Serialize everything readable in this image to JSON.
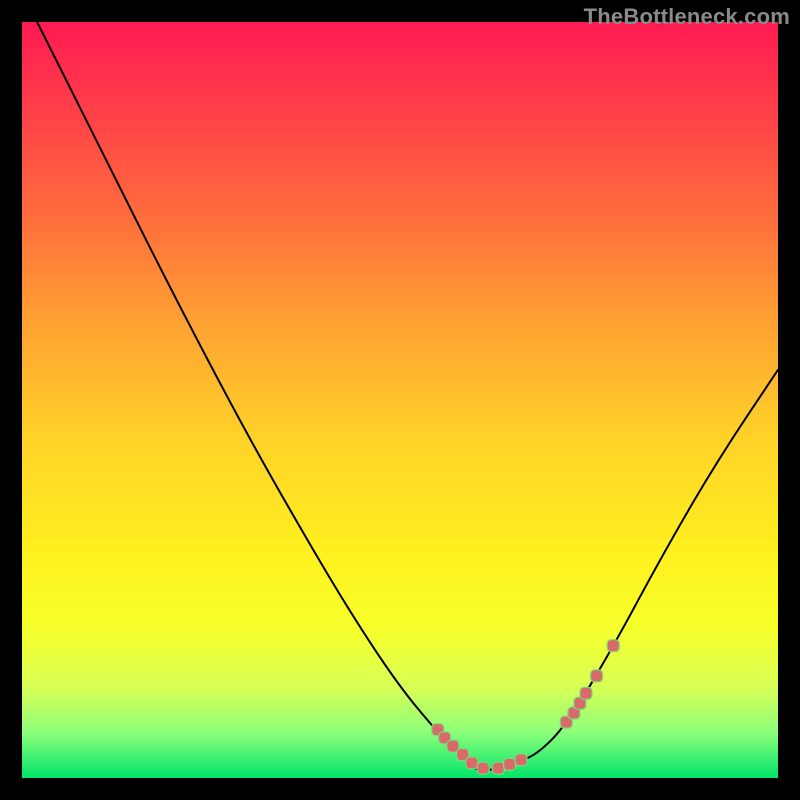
{
  "watermark": "TheBottleneck.com",
  "colors": {
    "frame_bg_top": "#ff1a53",
    "frame_bg_bottom": "#00e46a",
    "curve": "#000000",
    "marker_fill": "#d86a6a",
    "marker_stroke": "#7dd87d",
    "page_bg": "#000000",
    "watermark": "#8a8a8a"
  },
  "chart_data": {
    "type": "line",
    "title": "",
    "xlabel": "",
    "ylabel": "",
    "xlim": [
      0,
      100
    ],
    "ylim": [
      0,
      100
    ],
    "grid": false,
    "legend": false,
    "series": [
      {
        "name": "bottleneck-curve",
        "x": [
          2,
          10,
          20,
          30,
          38,
          44,
          50,
          55,
          58,
          60,
          62,
          65,
          68,
          72,
          78,
          85,
          92,
          100
        ],
        "y": [
          100,
          84,
          64,
          45,
          31,
          21,
          12,
          6,
          3,
          1,
          1,
          2,
          3,
          7,
          17,
          30,
          42,
          54
        ]
      }
    ],
    "markers": {
      "name": "highlighted-points",
      "x": [
        55.0,
        55.9,
        57.0,
        58.3,
        59.5,
        61.0,
        63.0,
        64.5,
        66.0,
        72.0,
        73.0,
        73.8,
        74.6,
        76.0,
        78.2
      ],
      "y": [
        6.4,
        5.3,
        4.2,
        3.1,
        2.0,
        1.3,
        1.3,
        1.8,
        2.4,
        7.4,
        8.6,
        9.9,
        11.2,
        13.5,
        17.5
      ]
    }
  }
}
